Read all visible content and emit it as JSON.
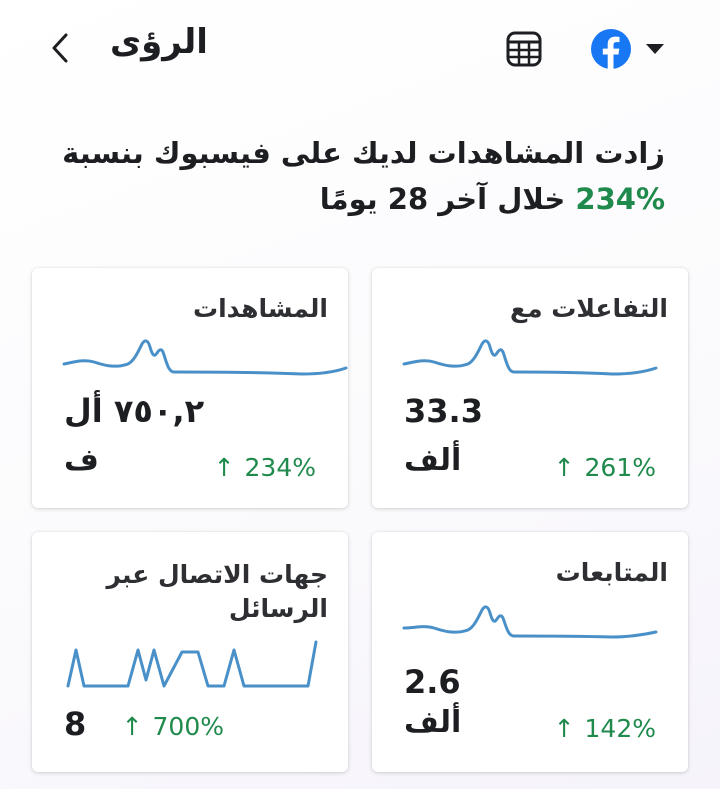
{
  "header": {
    "title": "الرؤى",
    "back_icon": "chevron-left-icon",
    "table_icon": "table-icon",
    "platform_icon": "facebook-icon",
    "dropdown_icon": "caret-down-icon"
  },
  "summary": {
    "line1": "زادت المشاهدات لديك على فيسبوك بنسبة",
    "percent": "234%",
    "line2": "خلال آخر 28 يومًا"
  },
  "cards": [
    {
      "title": "المشاهدات",
      "value": "٧٥٠,٢ أل",
      "unit": "ف",
      "change": "234%",
      "arrow": "↑"
    },
    {
      "title": "التفاعلات مع",
      "value": "33.3",
      "unit": "ألف",
      "change": "261%",
      "arrow": "↑"
    },
    {
      "title": "جهات الاتصال عبر الرسائل",
      "value": "8",
      "unit": "",
      "change": "700%",
      "arrow": "↑"
    },
    {
      "title": "المتابعات",
      "value": "2.6",
      "unit": "ألف",
      "change": "142%",
      "arrow": "↑"
    }
  ],
  "colors": {
    "accent_green": "#1f8a4c",
    "sparkline": "#4a90c8",
    "facebook_blue": "#1877f2"
  }
}
